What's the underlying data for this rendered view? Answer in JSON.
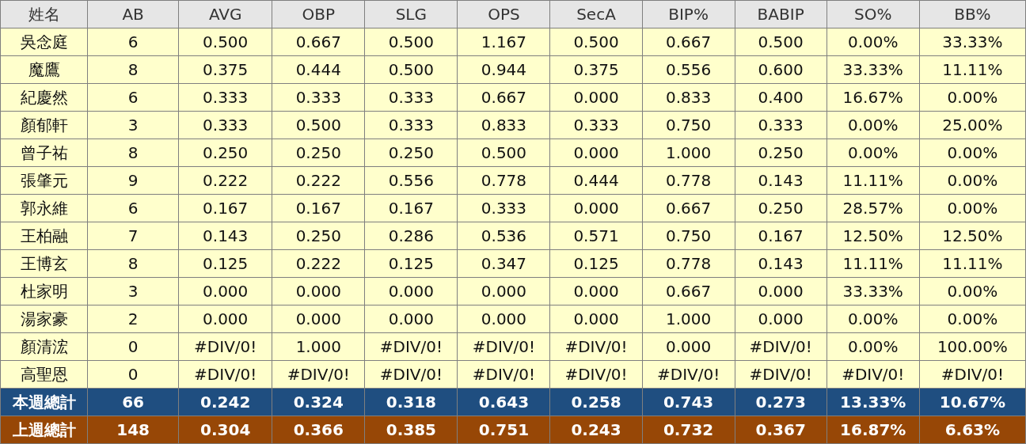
{
  "table": {
    "columns": [
      "姓名",
      "AB",
      "AVG",
      "OBP",
      "SLG",
      "OPS",
      "SecA",
      "BIP%",
      "BABIP",
      "SO%",
      "BB%"
    ],
    "rows": [
      {
        "kind": "player",
        "cells": [
          "吳念庭",
          "6",
          "0.500",
          "0.667",
          "0.500",
          "1.167",
          "0.500",
          "0.667",
          "0.500",
          "0.00%",
          "33.33%"
        ]
      },
      {
        "kind": "player",
        "cells": [
          "魔鷹",
          "8",
          "0.375",
          "0.444",
          "0.500",
          "0.944",
          "0.375",
          "0.556",
          "0.600",
          "33.33%",
          "11.11%"
        ]
      },
      {
        "kind": "player",
        "cells": [
          "紀慶然",
          "6",
          "0.333",
          "0.333",
          "0.333",
          "0.667",
          "0.000",
          "0.833",
          "0.400",
          "16.67%",
          "0.00%"
        ]
      },
      {
        "kind": "player",
        "cells": [
          "顏郁軒",
          "3",
          "0.333",
          "0.500",
          "0.333",
          "0.833",
          "0.333",
          "0.750",
          "0.333",
          "0.00%",
          "25.00%"
        ]
      },
      {
        "kind": "player",
        "cells": [
          "曾子祐",
          "8",
          "0.250",
          "0.250",
          "0.250",
          "0.500",
          "0.000",
          "1.000",
          "0.250",
          "0.00%",
          "0.00%"
        ]
      },
      {
        "kind": "player",
        "cells": [
          "張肇元",
          "9",
          "0.222",
          "0.222",
          "0.556",
          "0.778",
          "0.444",
          "0.778",
          "0.143",
          "11.11%",
          "0.00%"
        ]
      },
      {
        "kind": "player",
        "cells": [
          "郭永維",
          "6",
          "0.167",
          "0.167",
          "0.167",
          "0.333",
          "0.000",
          "0.667",
          "0.250",
          "28.57%",
          "0.00%"
        ]
      },
      {
        "kind": "player",
        "cells": [
          "王柏融",
          "7",
          "0.143",
          "0.250",
          "0.286",
          "0.536",
          "0.571",
          "0.750",
          "0.167",
          "12.50%",
          "12.50%"
        ]
      },
      {
        "kind": "player",
        "cells": [
          "王博玄",
          "8",
          "0.125",
          "0.222",
          "0.125",
          "0.347",
          "0.125",
          "0.778",
          "0.143",
          "11.11%",
          "11.11%"
        ]
      },
      {
        "kind": "player",
        "cells": [
          "杜家明",
          "3",
          "0.000",
          "0.000",
          "0.000",
          "0.000",
          "0.000",
          "0.667",
          "0.000",
          "33.33%",
          "0.00%"
        ]
      },
      {
        "kind": "player",
        "cells": [
          "湯家豪",
          "2",
          "0.000",
          "0.000",
          "0.000",
          "0.000",
          "0.000",
          "1.000",
          "0.000",
          "0.00%",
          "0.00%"
        ]
      },
      {
        "kind": "player",
        "cells": [
          "顏清浤",
          "0",
          "#DIV/0!",
          "1.000",
          "#DIV/0!",
          "#DIV/0!",
          "#DIV/0!",
          "0.000",
          "#DIV/0!",
          "0.00%",
          "100.00%"
        ]
      },
      {
        "kind": "player",
        "cells": [
          "高聖恩",
          "0",
          "#DIV/0!",
          "#DIV/0!",
          "#DIV/0!",
          "#DIV/0!",
          "#DIV/0!",
          "#DIV/0!",
          "#DIV/0!",
          "#DIV/0!",
          "#DIV/0!"
        ]
      },
      {
        "kind": "this_week_total",
        "cells": [
          "本週總計",
          "66",
          "0.242",
          "0.324",
          "0.318",
          "0.643",
          "0.258",
          "0.743",
          "0.273",
          "13.33%",
          "10.67%"
        ]
      },
      {
        "kind": "last_week_total",
        "cells": [
          "上週總計",
          "148",
          "0.304",
          "0.366",
          "0.385",
          "0.751",
          "0.243",
          "0.732",
          "0.367",
          "16.87%",
          "6.63%"
        ]
      }
    ]
  }
}
